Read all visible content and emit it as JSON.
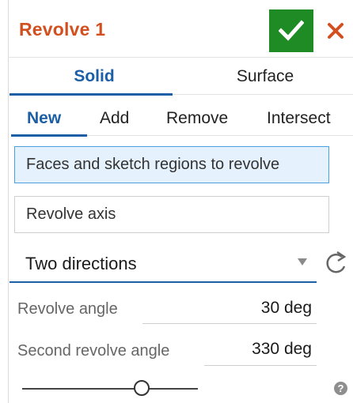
{
  "feature": {
    "title": "Revolve 1",
    "accept_icon": "checkmark-icon",
    "cancel_icon": "close-icon"
  },
  "body_type_tabs": [
    {
      "label": "Solid",
      "active": true
    },
    {
      "label": "Surface",
      "active": false
    }
  ],
  "operation_tabs": [
    {
      "label": "New",
      "active": true
    },
    {
      "label": "Add",
      "active": false
    },
    {
      "label": "Remove",
      "active": false
    },
    {
      "label": "Intersect",
      "active": false
    }
  ],
  "fields": {
    "faces_placeholder": "Faces and sketch regions to revolve",
    "axis_placeholder": "Revolve axis"
  },
  "revolve_type": {
    "selected": "Two directions",
    "flip_icon": "flip-direction-icon"
  },
  "angles": {
    "first_label": "Revolve angle",
    "first_value": "30 deg",
    "second_label": "Second revolve angle",
    "second_value": "330 deg"
  },
  "slider": {
    "value_fraction": 0.68
  },
  "help_icon": "help-icon",
  "colors": {
    "accent": "#1c5fa6",
    "title": "#d2501f",
    "accept": "#1f8b24",
    "cancel": "#d2501f",
    "active_field_bg": "#e5f2fd"
  }
}
